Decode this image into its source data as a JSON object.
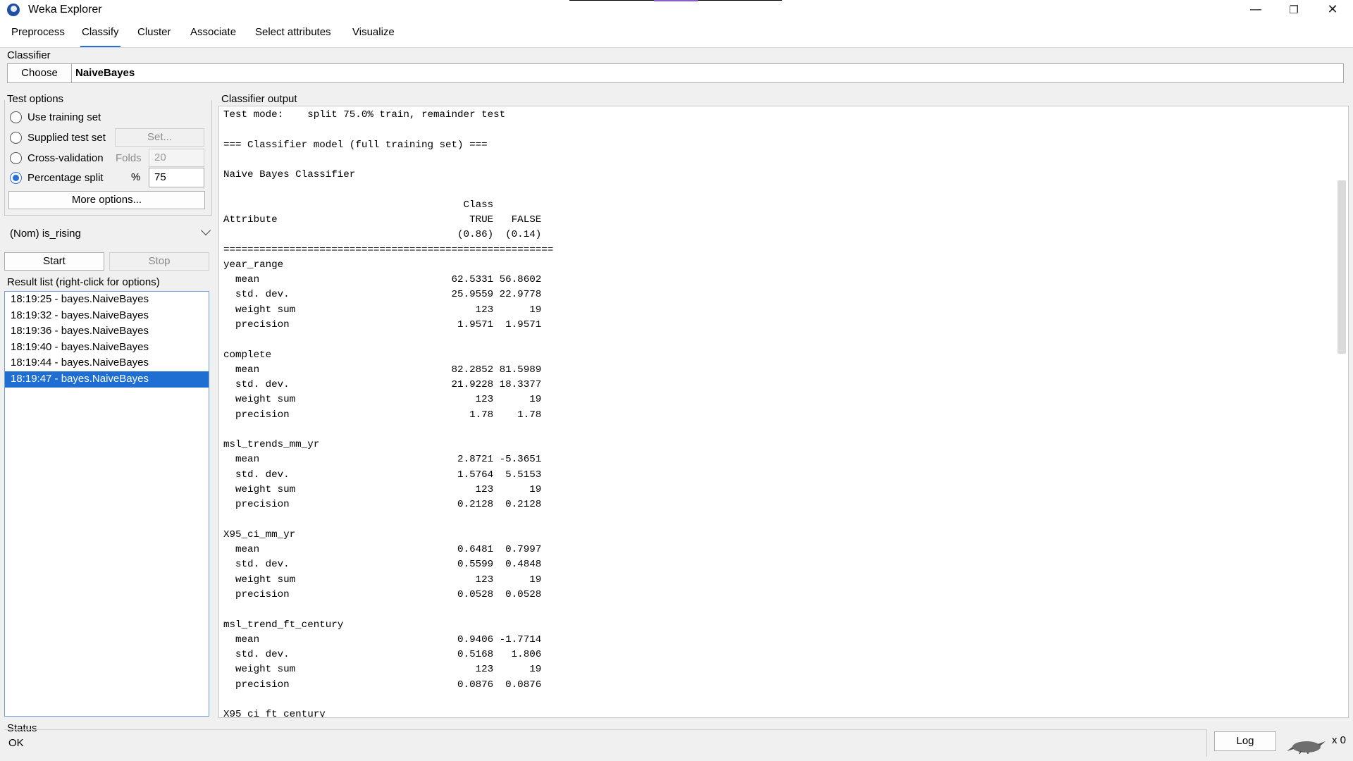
{
  "window": {
    "title": "Weka Explorer",
    "minimize": "—",
    "maximize": "❐",
    "close": "✕"
  },
  "tabs": [
    "Preprocess",
    "Classify",
    "Cluster",
    "Associate",
    "Select attributes",
    "Visualize"
  ],
  "active_tab": "Classify",
  "classifier": {
    "group_label": "Classifier",
    "choose_label": "Choose",
    "name": "NaiveBayes"
  },
  "test_options": {
    "group_label": "Test options",
    "use_training_set": "Use training set",
    "supplied_test_set": "Supplied test set",
    "set_button": "Set...",
    "cross_validation": "Cross-validation",
    "folds_label": "Folds",
    "folds_value": "20",
    "percentage_split": "Percentage split",
    "percent_label": "%",
    "percent_value": "75",
    "selected": "percentage_split",
    "more_options": "More options..."
  },
  "class_attribute": "(Nom) is_rising",
  "actions": {
    "start": "Start",
    "stop": "Stop"
  },
  "result_list": {
    "label": "Result list (right-click for options)",
    "items": [
      "18:19:25 - bayes.NaiveBayes",
      "18:19:32 - bayes.NaiveBayes",
      "18:19:36 - bayes.NaiveBayes",
      "18:19:40 - bayes.NaiveBayes",
      "18:19:44 - bayes.NaiveBayes",
      "18:19:47 - bayes.NaiveBayes"
    ],
    "selected_index": 5
  },
  "output": {
    "label": "Classifier output",
    "text": "Test mode:    split 75.0% train, remainder test\n\n=== Classifier model (full training set) ===\n\nNaive Bayes Classifier\n\n                                        Class\nAttribute                                TRUE   FALSE\n                                       (0.86)  (0.14)\n=======================================================\nyear_range\n  mean                                62.5331 56.8602\n  std. dev.                           25.9559 22.9778\n  weight sum                              123      19\n  precision                            1.9571  1.9571\n\ncomplete\n  mean                                82.2852 81.5989\n  std. dev.                           21.9228 18.3377\n  weight sum                              123      19\n  precision                              1.78    1.78\n\nmsl_trends_mm_yr\n  mean                                 2.8721 -5.3651\n  std. dev.                            1.5764  5.5153\n  weight sum                              123      19\n  precision                            0.2128  0.2128\n\nX95_ci_mm_yr\n  mean                                 0.6481  0.7997\n  std. dev.                            0.5599  0.4848\n  weight sum                              123      19\n  precision                            0.0528  0.0528\n\nmsl_trend_ft_century\n  mean                                 0.9406 -1.7714\n  std. dev.                            0.5168   1.806\n  weight sum                              123      19\n  precision                            0.0876  0.0876\n\nX95_ci_ft_century"
  },
  "status": {
    "label": "Status",
    "text": "OK",
    "log_button": "Log",
    "count": "x 0"
  },
  "colors": {
    "accent": "#2a6fd6",
    "selection": "#1e6fd1"
  }
}
